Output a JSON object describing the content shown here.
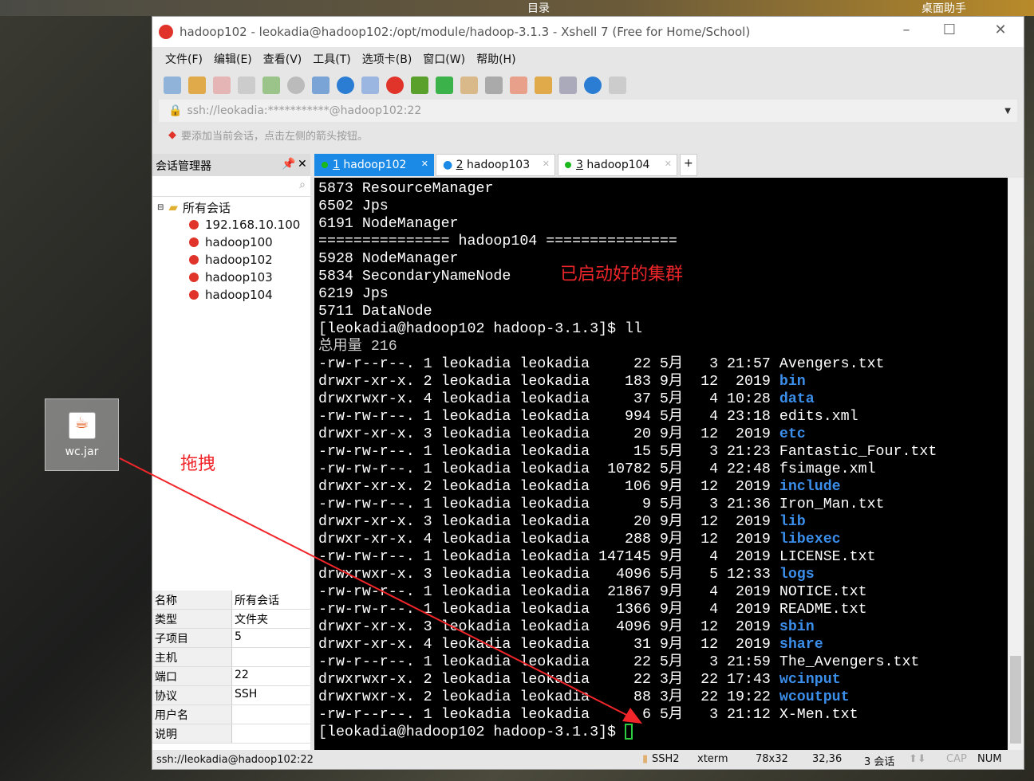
{
  "taskbar": {
    "center": "目录",
    "right": "桌面助手"
  },
  "window": {
    "title": "hadoop102 - leokadia@hadoop102:/opt/module/hadoop-3.1.3 - Xshell 7 (Free for Home/School)"
  },
  "menu": [
    "文件(F)",
    "编辑(E)",
    "查看(V)",
    "工具(T)",
    "选项卡(B)",
    "窗口(W)",
    "帮助(H)"
  ],
  "address": "ssh://leokadia:***********@hadoop102:22",
  "hint": "要添加当前会话，点击左侧的箭头按钮。",
  "session_manager": {
    "title": "会话管理器",
    "root": "所有会话",
    "items": [
      "192.168.10.100",
      "hadoop100",
      "hadoop102",
      "hadoop103",
      "hadoop104"
    ]
  },
  "properties": [
    [
      "名称",
      "所有会话"
    ],
    [
      "类型",
      "文件夹"
    ],
    [
      "子项目",
      "5"
    ],
    [
      "主机",
      ""
    ],
    [
      "端口",
      "22"
    ],
    [
      "协议",
      "SSH"
    ],
    [
      "用户名",
      ""
    ],
    [
      "说明",
      ""
    ]
  ],
  "tabs": [
    {
      "num": "1",
      "label": "hadoop102",
      "status": "green"
    },
    {
      "num": "2",
      "label": "hadoop103",
      "status": "info"
    },
    {
      "num": "3",
      "label": "hadoop104",
      "status": "green"
    }
  ],
  "terminal": {
    "head": [
      "5873 ResourceManager",
      "6502 Jps",
      "6191 NodeManager",
      "=============== hadoop104 ===============",
      "5928 NodeManager",
      "5834 SecondaryNameNode",
      "6219 Jps",
      "5711 DataNode",
      "[leokadia@hadoop102 hadoop-3.1.3]$ ll"
    ],
    "total": "总用量 216",
    "listing": [
      [
        "-rw-r--r--.",
        "1",
        "leokadia",
        "leokadia",
        "22",
        "5月",
        "3",
        "21:57",
        "Avengers.txt",
        false
      ],
      [
        "drwxr-xr-x.",
        "2",
        "leokadia",
        "leokadia",
        "183",
        "9月",
        "12",
        "2019",
        "bin",
        true
      ],
      [
        "drwxrwxr-x.",
        "4",
        "leokadia",
        "leokadia",
        "37",
        "5月",
        "4",
        "10:28",
        "data",
        true
      ],
      [
        "-rw-rw-r--.",
        "1",
        "leokadia",
        "leokadia",
        "994",
        "5月",
        "4",
        "23:18",
        "edits.xml",
        false
      ],
      [
        "drwxr-xr-x.",
        "3",
        "leokadia",
        "leokadia",
        "20",
        "9月",
        "12",
        "2019",
        "etc",
        true
      ],
      [
        "-rw-rw-r--.",
        "1",
        "leokadia",
        "leokadia",
        "15",
        "5月",
        "3",
        "21:23",
        "Fantastic_Four.txt",
        false
      ],
      [
        "-rw-rw-r--.",
        "1",
        "leokadia",
        "leokadia",
        "10782",
        "5月",
        "4",
        "22:48",
        "fsimage.xml",
        false
      ],
      [
        "drwxr-xr-x.",
        "2",
        "leokadia",
        "leokadia",
        "106",
        "9月",
        "12",
        "2019",
        "include",
        true
      ],
      [
        "-rw-rw-r--.",
        "1",
        "leokadia",
        "leokadia",
        "9",
        "5月",
        "3",
        "21:36",
        "Iron_Man.txt",
        false
      ],
      [
        "drwxr-xr-x.",
        "3",
        "leokadia",
        "leokadia",
        "20",
        "9月",
        "12",
        "2019",
        "lib",
        true
      ],
      [
        "drwxr-xr-x.",
        "4",
        "leokadia",
        "leokadia",
        "288",
        "9月",
        "12",
        "2019",
        "libexec",
        true
      ],
      [
        "-rw-rw-r--.",
        "1",
        "leokadia",
        "leokadia",
        "147145",
        "9月",
        "4",
        "2019",
        "LICENSE.txt",
        false
      ],
      [
        "drwxrwxr-x.",
        "3",
        "leokadia",
        "leokadia",
        "4096",
        "5月",
        "5",
        "12:33",
        "logs",
        true
      ],
      [
        "-rw-rw-r--.",
        "1",
        "leokadia",
        "leokadia",
        "21867",
        "9月",
        "4",
        "2019",
        "NOTICE.txt",
        false
      ],
      [
        "-rw-rw-r--.",
        "1",
        "leokadia",
        "leokadia",
        "1366",
        "9月",
        "4",
        "2019",
        "README.txt",
        false
      ],
      [
        "drwxr-xr-x.",
        "3",
        "leokadia",
        "leokadia",
        "4096",
        "9月",
        "12",
        "2019",
        "sbin",
        true
      ],
      [
        "drwxr-xr-x.",
        "4",
        "leokadia",
        "leokadia",
        "31",
        "9月",
        "12",
        "2019",
        "share",
        true
      ],
      [
        "-rw-r--r--.",
        "1",
        "leokadia",
        "leokadia",
        "22",
        "5月",
        "3",
        "21:59",
        "The_Avengers.txt",
        false
      ],
      [
        "drwxrwxr-x.",
        "2",
        "leokadia",
        "leokadia",
        "22",
        "3月",
        "22",
        "17:43",
        "wcinput",
        true
      ],
      [
        "drwxrwxr-x.",
        "2",
        "leokadia",
        "leokadia",
        "88",
        "3月",
        "22",
        "19:22",
        "wcoutput",
        true
      ],
      [
        "-rw-r--r--.",
        "1",
        "leokadia",
        "leokadia",
        "6",
        "5月",
        "3",
        "21:12",
        "X-Men.txt",
        false
      ]
    ],
    "prompt": "[leokadia@hadoop102 hadoop-3.1.3]$ "
  },
  "status": {
    "left": "ssh://leokadia@hadoop102:22",
    "protocol": "SSH2",
    "term": "xterm",
    "size": "78x32",
    "pos": "32,36",
    "sessions": "3 会话",
    "cap": "CAP",
    "num": "NUM"
  },
  "desktop_icon": "wc.jar",
  "annotations": {
    "cluster": "已启动好的集群",
    "drag": "拖拽"
  },
  "colors": {
    "accent": "#1a8ae6",
    "annotation": "#f0262a",
    "dir": "#3b8eea"
  }
}
